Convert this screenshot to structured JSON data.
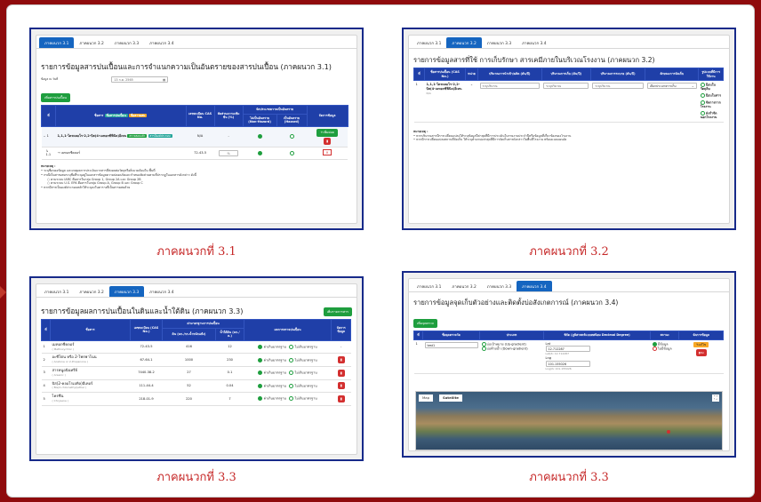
{
  "tabs": [
    "ภาคผนวก 3.1",
    "ภาคผนวก 3.2",
    "ภาคผนวก 3.3",
    "ภาคผนวก 3.4"
  ],
  "captions": [
    "ภาคผนวกที่ 3.1",
    "ภาคผนวกที่ 3.2",
    "ภาคผนวกที่ 3.3",
    "ภาคผนวกที่ 3.3"
  ],
  "colors": {
    "accent": "#1565c0",
    "header": "#1f3fa8",
    "green": "#1e9e3e",
    "red": "#d32f2f",
    "caption": "#c62828",
    "border": "#8f0b0d",
    "frame": "#172a8a"
  },
  "p1": {
    "title": "รายการข้อมูลสารปนเปื้อนและการจำแนกความเป็นอันตรายของสารปนเปื้อน (ภาคผนวก 3.1)",
    "date_label": "ข้อมูล ณ วันที่",
    "date_value": "13 ก.ค. 2565",
    "add_button": "เพิ่มสารปนเปื้อน",
    "headers": {
      "num": "ที่",
      "name": "ชื่อสาร",
      "badge1": "ชื่อสารปนเปื้อน",
      "badge2": "ชื่อสารผสม",
      "cas": "เลขทะเบียน CAS No.",
      "pct": "สัดส่วนความเข้มข้น (%)",
      "hazard": "จัดประเภทความเป็นอันตราย",
      "non": "ไม่เป็นอันตราย (Non-Hazard)",
      "haz": "เป็นอันตราย (Hazard)",
      "manage": "จัดการข้อมูล"
    },
    "row1": {
      "num": "1",
      "name": "1,1,1-ไตรคลอโร-2,2-บิส(4-เมทอกซีฟีนิล)อีเทน",
      "tag1": "ตรวจสอบแล้ว",
      "tag2": "สารมีองค์ประกอบ",
      "cas": "N/A",
      "pct": "-",
      "add": "เพิ่มย่อย",
      "del": "ลบ"
    },
    "row2": {
      "num": "1.1",
      "name": "เมทอกซีคลอร์",
      "cas": "72-43-5",
      "pct": "%",
      "del": "×"
    },
    "notes": {
      "head": "หมายเหตุ :",
      "lines": [
        "ระบุชื่อของข้อมูล และเหตุผลการประเมินจากสารที่ส่งผลต่อวัตถุหรือสิ่งแวดล้อมใน พื้นที่",
        "กรณีเป็นสารผสมระบุชื่อที่ระบุอยู่ในเอกสารข้อมูลความปลอดภัยและกำหนดสัดส่วนตามที่ปรากฏในเอกสารดังกล่าว ดังนี้",
        "ตามระบบ IARC คือสารในกลุ่ม Group 1, Group 2A และ Group 2B",
        "ตามระบบ U.S. EPA คือสารในกลุ่ม Group A, Group B และ Group C",
        "หากมีสารเป็นองค์ประกอบหลักให้ระบุลงในตารางที่เป็นสารผสมด้วย"
      ]
    }
  },
  "p2": {
    "title": "รายการข้อมูลสารที่ใช้ การเก็บรักษา สารเคมีภายในบริเวณโรงงาน (ภาคผนวก 3.2)",
    "headers": {
      "num": "ที่",
      "name": "ชื่อสารปนเปื้อน (CAS No.)",
      "unit": "หน่วย",
      "qty_use": "ปริมาณการนำเข้า/ผลิต (ตัน/ปี)",
      "qty_store": "ปริมาณการเก็บ (ตัน/ปี)",
      "qty_release": "ปริมาณการระบาย (ตัน/ปี)",
      "location": "ลักษณะการจัดเก็บ",
      "exposure": "รูปแบบที่มีการใช้งาน"
    },
    "row": {
      "num": "1",
      "name": "1,1,1-ไตรคลอโร-2,2-บิส(4-เมทอกซีฟีนิล)อีเทน",
      "cas": "N/A",
      "ph1": "ระบุปริมาณ",
      "ph2": "ระบุปริมาณ",
      "ph3": "ระบุปริมาณ",
      "select": "เลือกประเภทการเก็บ",
      "opts": [
        "ป้อนในวัตถุดิบ",
        "ป้อนในสาร",
        "จัดการกากโรงงาน",
        "ส่งกำจัดนอกโรงงาน"
      ]
    },
    "notes": {
      "head": "หมายเหตุ :",
      "lines": [
        "หากปริมาณสารมีการเปลี่ยนแปลงให้ระบุข้อมูลปีล่าสุดที่มีการประเมินในรายงานประจำปีหรือข้อมูลที่เกี่ยวข้องของโรงงาน",
        "หากมีการเปลี่ยนแปลงสถานที่จัดเก็บ ให้ระบุตำแหน่งล่าสุดที่มีการจัดเก็บสารดังกล่าวในพื้นที่โรงงาน พร้อมแนบแผนผัง"
      ]
    }
  },
  "p3": {
    "title": "รายการข้อมูลผลการปนเปื้อนในดินและน้ำใต้ดิน (ภาคผนวก 3.3)",
    "add_button": "เพิ่มรายการสาร",
    "headers": {
      "num": "ที่",
      "name": "ชื่อสาร",
      "cas": "เลขทะเบียน (CAS No.)",
      "std": "ค่ามาตรฐานการปนเปื้อน",
      "soil": "ดิน (มก./กก.น้ำหนักแห้ง)",
      "water": "น้ำใต้ดิน (มก./ล.)",
      "exceed": "ผลการตรวจปนเปื้อน",
      "manage": "จัดการข้อมูล"
    },
    "pass_label": "ค่าเกินมาตรฐาน",
    "fail_label": "ไม่เกินมาตรฐาน",
    "rows": [
      {
        "num": "1",
        "name": "เมทอกซีคลอร์",
        "en": "( Methoxychlor )",
        "cas": "72-43-5",
        "soil": "416",
        "water": "12",
        "man": "-"
      },
      {
        "num": "2",
        "name": "อะซีโตน หรือ 2-โพรพาโนน",
        "en": "( Acetone or 2-Propanone )",
        "cas": "67-64-1",
        "soil": "1000",
        "water": "230",
        "man": "del"
      },
      {
        "num": "3",
        "name": "สารหนูอนินทรีย์",
        "en": "( Arsenic )",
        "cas": "7440-38-2",
        "soil": "27",
        "water": "0.1",
        "man": "del"
      },
      {
        "num": "4",
        "name": "บิส(2-คลอโรเอทิล)อีเทอร์",
        "en": "( Bis(2-chloroethyl)ether )",
        "cas": "111-44-4",
        "soil": "52",
        "water": "0.04",
        "man": "del"
      },
      {
        "num": "5",
        "name": "ไครซีน",
        "en": "( Chrysene )",
        "cas": "218-01-9",
        "soil": "220",
        "water": "7",
        "man": "del"
      }
    ]
  },
  "p4": {
    "title": "รายการข้อมูลจุดเก็บตัวอย่างและติดตั้งบ่อสังเกตการณ์ (ภาคผนวก 3.4)",
    "add_button": "เพิ่มจุดตรวจ",
    "headers": {
      "num": "ที่",
      "point": "ชื่อจุดตรวจวัด",
      "type": "ประเภท",
      "coord": "พิกัด (ภูมิศาสตร์แบบทศนิยม Decimal Degree)",
      "status": "สถานะ",
      "manage": "จัดการข้อมูล"
    },
    "row": {
      "num": "1",
      "point": "test1",
      "t1": "บ่อเป้าหมาย (Up-gradient)",
      "t2": "บ่อท้ายน้ำ (Down-gradient)",
      "lat_label": "Lat",
      "lat": "12.712287",
      "lat_sub": "Lat(ละ 12.712287",
      "lng_label": "Lng",
      "lng": "101.155026",
      "lng_sub": "Lng(ละ 101.155026",
      "s1": "มีข้อมูล",
      "s2": "ไม่มีข้อมูล",
      "edit": "แก้ไข",
      "del": "ลบ"
    },
    "map": {
      "map_label": "Map",
      "sat_label": "Satellite",
      "fullscreen": "⛶"
    }
  }
}
